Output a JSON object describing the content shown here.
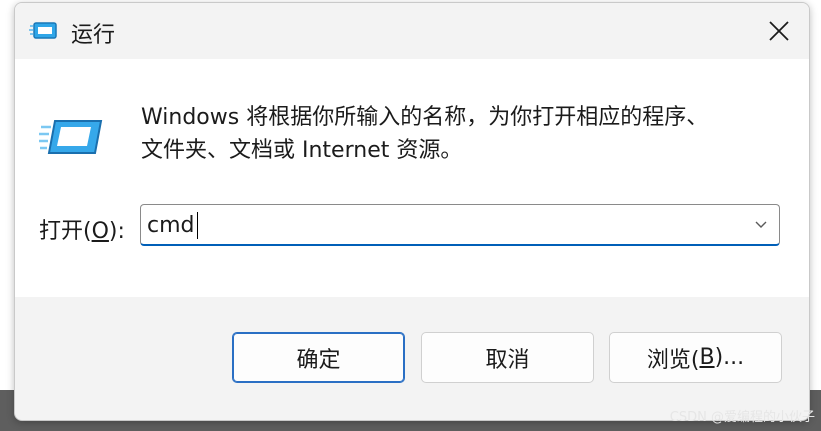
{
  "window": {
    "title": "运行",
    "close_icon": "close-icon"
  },
  "dialog": {
    "app_icon": "run-dialog-icon",
    "description_line1": "Windows 将根据你所输入的名称，为你打开相应的程序、",
    "description_line2": "文件夹、文档或 Internet 资源。",
    "open_label_prefix": "打开(",
    "open_label_mnemonic": "O",
    "open_label_suffix": "):",
    "open_value": "cmd",
    "dropdown_icon": "chevron-down-icon"
  },
  "buttons": {
    "ok_label": "确定",
    "cancel_label": "取消",
    "browse_prefix": "浏览(",
    "browse_mnemonic": "B",
    "browse_suffix": ")..."
  },
  "watermark": "CSDN @爱编程的小伙子",
  "colors": {
    "accent": "#005fb8",
    "primary_border": "#2a6fc4",
    "window_bg": "#f3f3f3",
    "content_bg": "#ffffff"
  }
}
